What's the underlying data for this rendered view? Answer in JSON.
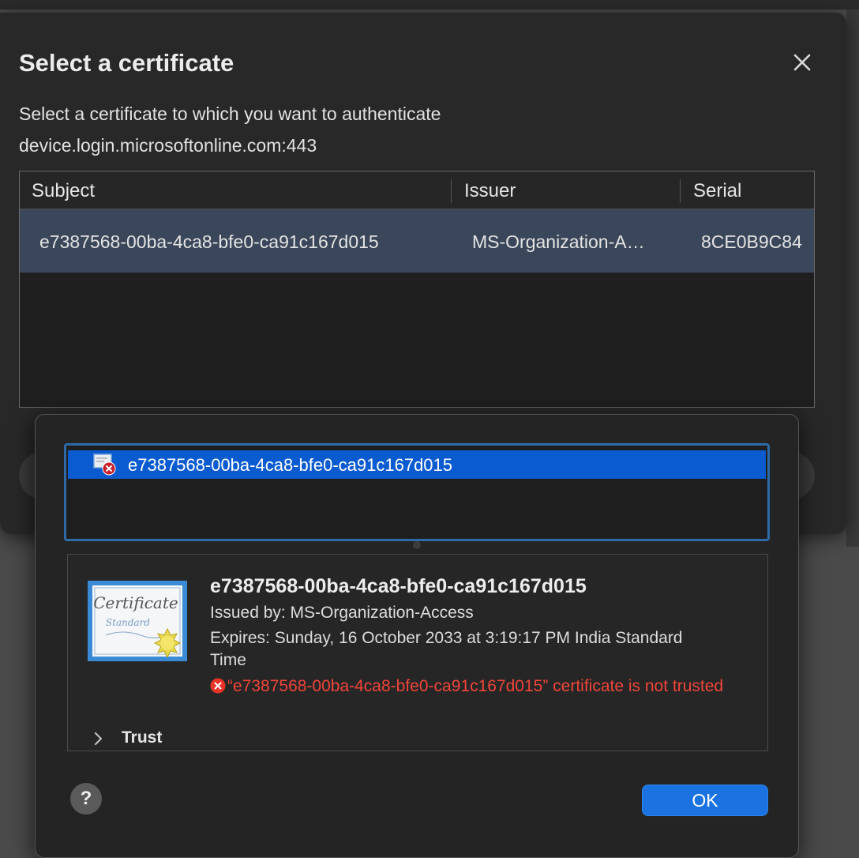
{
  "dialog": {
    "title": "Select a certificate",
    "description_line1": "Select a certificate to which you want to authenticate",
    "description_line2": "device.login.microsoftonline.com:443",
    "table": {
      "columns": [
        "Subject",
        "Issuer",
        "Serial"
      ],
      "rows": [
        {
          "subject": "e7387568-00ba-4ca8-bfe0-ca91c167d015",
          "issuer": "MS-Organization-A…",
          "serial": "8CE0B9C84"
        }
      ]
    }
  },
  "sheet": {
    "list": {
      "items": [
        {
          "label": "e7387568-00ba-4ca8-bfe0-ca91c167d015",
          "icon": "certificate-invalid-icon"
        }
      ]
    },
    "detail": {
      "name": "e7387568-00ba-4ca8-bfe0-ca91c167d015",
      "issued_by": "Issued by: MS-Organization-Access",
      "expires": "Expires: Sunday, 16 October 2033 at 3:19:17 PM India Standard Time",
      "error": "“e7387568-00ba-4ca8-bfe0-ca91c167d015” certificate is not trusted",
      "cert_image_text_1": "Certificate",
      "cert_image_text_2": "Standard",
      "trust_label": "Trust"
    },
    "help_label": "?",
    "ok_label": "OK"
  },
  "colors": {
    "selection_blue": "#0a5bd0",
    "table_selection": "#3a4659",
    "error_red": "#f0453a",
    "ok_button": "#1a73e0"
  }
}
